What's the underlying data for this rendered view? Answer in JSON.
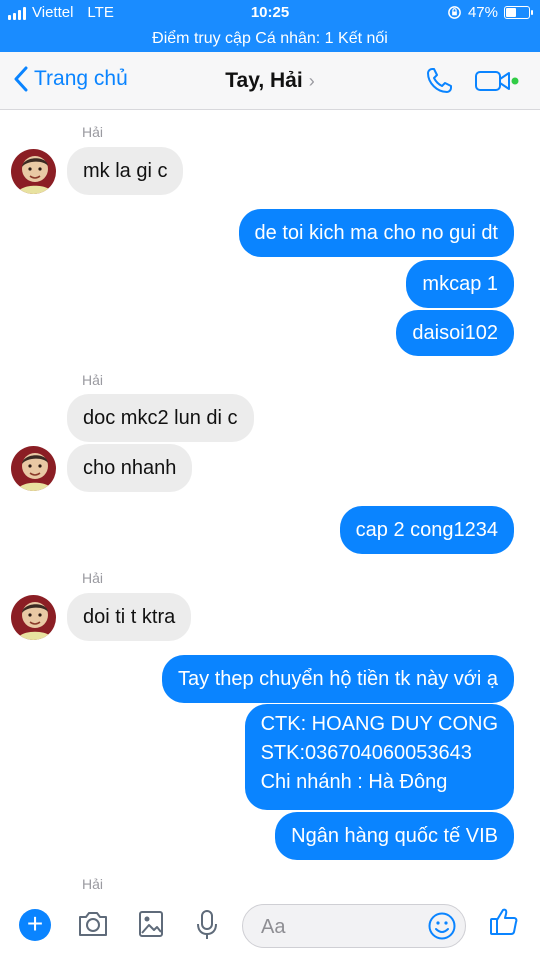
{
  "status_bar": {
    "carrier": "Viettel",
    "network": "LTE",
    "time": "10:25",
    "battery_percent": "47%",
    "battery_level": 0.47
  },
  "hotspot_banner": "Điểm truy cập Cá nhân: 1 Kết nối",
  "header": {
    "back_label": "Trang chủ",
    "title": "Tay, Hải",
    "title_chevron": "›"
  },
  "messages": {
    "sender_1": "Hải",
    "m1": "mk la gi c",
    "m2": "de toi kich ma cho no gui dt",
    "m3": "mkcap 1",
    "m4": "daisoi102",
    "sender_2": "Hải",
    "m5": "doc mkc2 lun di c",
    "m6": "cho nhanh",
    "m7": "cap 2 cong1234",
    "sender_3": "Hải",
    "m8": "doi ti t ktra",
    "m9": "Tay thep chuyển hộ tiền tk này với ạ",
    "m10": "CTK: HOANG DUY CONG\nSTK:036704060053643\nChi nhánh : Hà Đông",
    "m11": "Ngân hàng quốc tế VIB",
    "sender_4": "Hải"
  },
  "composer": {
    "placeholder": "Aa",
    "plus_label": "+"
  },
  "colors": {
    "accent": "#0a84ff",
    "status_bar": "#1a8cff",
    "incoming_bubble": "#ececec",
    "online_dot": "#31cc46"
  },
  "icons": [
    "back-chevron-icon",
    "phone-icon",
    "video-camera-icon",
    "plus-icon",
    "camera-icon",
    "image-icon",
    "microphone-icon",
    "smiley-icon",
    "thumbs-up-icon"
  ]
}
